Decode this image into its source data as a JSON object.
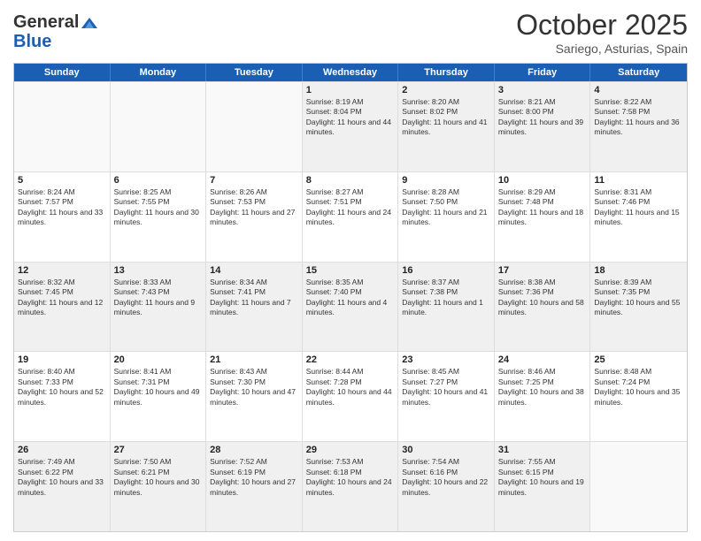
{
  "logo": {
    "general": "General",
    "blue": "Blue"
  },
  "title": "October 2025",
  "subtitle": "Sariego, Asturias, Spain",
  "weekdays": [
    "Sunday",
    "Monday",
    "Tuesday",
    "Wednesday",
    "Thursday",
    "Friday",
    "Saturday"
  ],
  "rows": [
    [
      {
        "day": "",
        "empty": true
      },
      {
        "day": "",
        "empty": true
      },
      {
        "day": "",
        "empty": true
      },
      {
        "day": "1",
        "sunrise": "8:19 AM",
        "sunset": "8:04 PM",
        "daylight": "11 hours and 44 minutes."
      },
      {
        "day": "2",
        "sunrise": "8:20 AM",
        "sunset": "8:02 PM",
        "daylight": "11 hours and 41 minutes."
      },
      {
        "day": "3",
        "sunrise": "8:21 AM",
        "sunset": "8:00 PM",
        "daylight": "11 hours and 39 minutes."
      },
      {
        "day": "4",
        "sunrise": "8:22 AM",
        "sunset": "7:58 PM",
        "daylight": "11 hours and 36 minutes."
      }
    ],
    [
      {
        "day": "5",
        "sunrise": "8:24 AM",
        "sunset": "7:57 PM",
        "daylight": "11 hours and 33 minutes."
      },
      {
        "day": "6",
        "sunrise": "8:25 AM",
        "sunset": "7:55 PM",
        "daylight": "11 hours and 30 minutes."
      },
      {
        "day": "7",
        "sunrise": "8:26 AM",
        "sunset": "7:53 PM",
        "daylight": "11 hours and 27 minutes."
      },
      {
        "day": "8",
        "sunrise": "8:27 AM",
        "sunset": "7:51 PM",
        "daylight": "11 hours and 24 minutes."
      },
      {
        "day": "9",
        "sunrise": "8:28 AM",
        "sunset": "7:50 PM",
        "daylight": "11 hours and 21 minutes."
      },
      {
        "day": "10",
        "sunrise": "8:29 AM",
        "sunset": "7:48 PM",
        "daylight": "11 hours and 18 minutes."
      },
      {
        "day": "11",
        "sunrise": "8:31 AM",
        "sunset": "7:46 PM",
        "daylight": "11 hours and 15 minutes."
      }
    ],
    [
      {
        "day": "12",
        "sunrise": "8:32 AM",
        "sunset": "7:45 PM",
        "daylight": "11 hours and 12 minutes."
      },
      {
        "day": "13",
        "sunrise": "8:33 AM",
        "sunset": "7:43 PM",
        "daylight": "11 hours and 9 minutes."
      },
      {
        "day": "14",
        "sunrise": "8:34 AM",
        "sunset": "7:41 PM",
        "daylight": "11 hours and 7 minutes."
      },
      {
        "day": "15",
        "sunrise": "8:35 AM",
        "sunset": "7:40 PM",
        "daylight": "11 hours and 4 minutes."
      },
      {
        "day": "16",
        "sunrise": "8:37 AM",
        "sunset": "7:38 PM",
        "daylight": "11 hours and 1 minute."
      },
      {
        "day": "17",
        "sunrise": "8:38 AM",
        "sunset": "7:36 PM",
        "daylight": "10 hours and 58 minutes."
      },
      {
        "day": "18",
        "sunrise": "8:39 AM",
        "sunset": "7:35 PM",
        "daylight": "10 hours and 55 minutes."
      }
    ],
    [
      {
        "day": "19",
        "sunrise": "8:40 AM",
        "sunset": "7:33 PM",
        "daylight": "10 hours and 52 minutes."
      },
      {
        "day": "20",
        "sunrise": "8:41 AM",
        "sunset": "7:31 PM",
        "daylight": "10 hours and 49 minutes."
      },
      {
        "day": "21",
        "sunrise": "8:43 AM",
        "sunset": "7:30 PM",
        "daylight": "10 hours and 47 minutes."
      },
      {
        "day": "22",
        "sunrise": "8:44 AM",
        "sunset": "7:28 PM",
        "daylight": "10 hours and 44 minutes."
      },
      {
        "day": "23",
        "sunrise": "8:45 AM",
        "sunset": "7:27 PM",
        "daylight": "10 hours and 41 minutes."
      },
      {
        "day": "24",
        "sunrise": "8:46 AM",
        "sunset": "7:25 PM",
        "daylight": "10 hours and 38 minutes."
      },
      {
        "day": "25",
        "sunrise": "8:48 AM",
        "sunset": "7:24 PM",
        "daylight": "10 hours and 35 minutes."
      }
    ],
    [
      {
        "day": "26",
        "sunrise": "7:49 AM",
        "sunset": "6:22 PM",
        "daylight": "10 hours and 33 minutes."
      },
      {
        "day": "27",
        "sunrise": "7:50 AM",
        "sunset": "6:21 PM",
        "daylight": "10 hours and 30 minutes."
      },
      {
        "day": "28",
        "sunrise": "7:52 AM",
        "sunset": "6:19 PM",
        "daylight": "10 hours and 27 minutes."
      },
      {
        "day": "29",
        "sunrise": "7:53 AM",
        "sunset": "6:18 PM",
        "daylight": "10 hours and 24 minutes."
      },
      {
        "day": "30",
        "sunrise": "7:54 AM",
        "sunset": "6:16 PM",
        "daylight": "10 hours and 22 minutes."
      },
      {
        "day": "31",
        "sunrise": "7:55 AM",
        "sunset": "6:15 PM",
        "daylight": "10 hours and 19 minutes."
      },
      {
        "day": "",
        "empty": true
      }
    ]
  ]
}
